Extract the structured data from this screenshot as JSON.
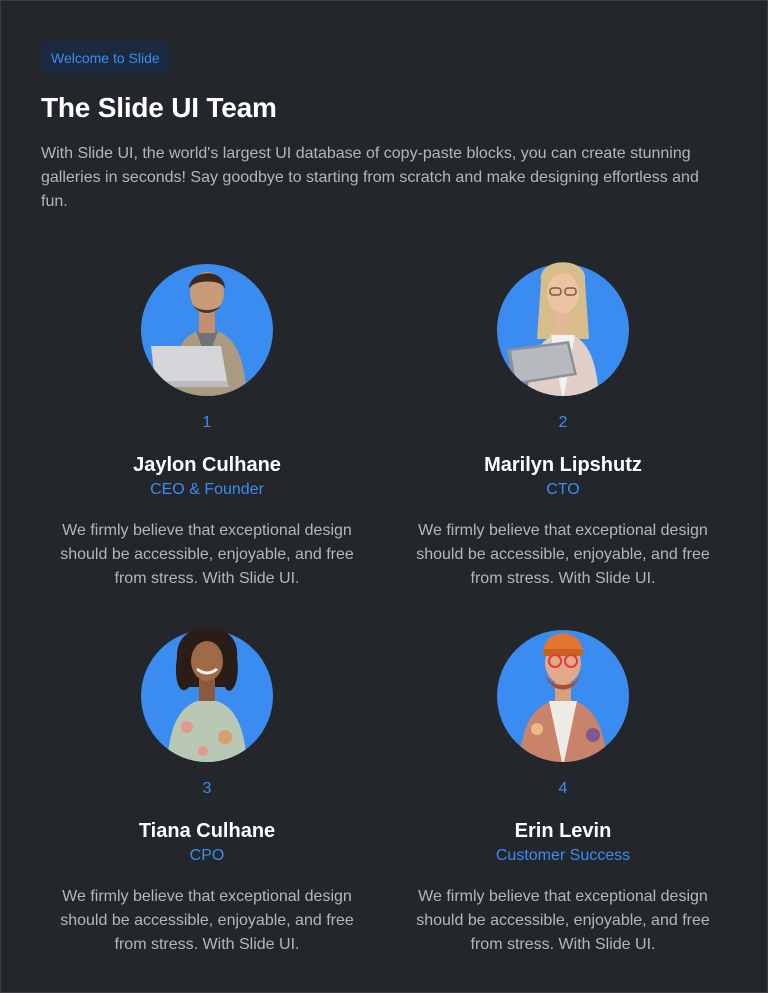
{
  "header": {
    "badge": "Welcome to Slide",
    "title": "The Slide UI Team",
    "intro": "With Slide UI, the world's largest UI database of copy-paste blocks, you can create stunning galleries in seconds! Say goodbye to starting from scratch and make designing effortless and fun."
  },
  "colors": {
    "background": "#23272c",
    "accent": "#3b8cf0",
    "muted_text": "#b2b7bf"
  },
  "team": [
    {
      "number": "1",
      "name": "Jaylon Culhane",
      "role": "CEO & Founder",
      "bio": "We firmly believe that exceptional design should be accessible, enjoyable, and free from stress. With Slide UI."
    },
    {
      "number": "2",
      "name": "Marilyn Lipshutz",
      "role": "CTO",
      "bio": "We firmly believe that exceptional design should be accessible, enjoyable, and free from stress. With Slide UI."
    },
    {
      "number": "3",
      "name": "Tiana Culhane",
      "role": "CPO",
      "bio": "We firmly believe that exceptional design should be accessible, enjoyable, and free from stress. With Slide UI."
    },
    {
      "number": "4",
      "name": "Erin Levin",
      "role": "Customer Success",
      "bio": "We firmly believe that exceptional design should be accessible, enjoyable, and free from stress. With Slide UI."
    }
  ]
}
